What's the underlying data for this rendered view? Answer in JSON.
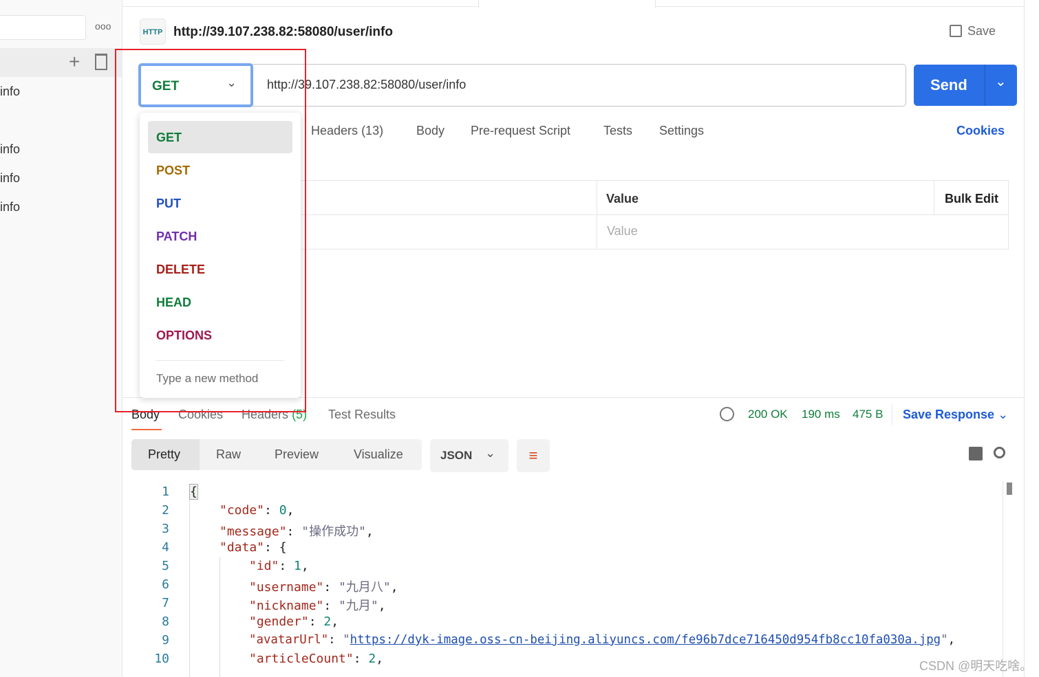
{
  "sidebar": {
    "items": [
      "info",
      "info",
      "info",
      "info"
    ],
    "more_icon": "ellipsis-icon"
  },
  "request": {
    "title": "http://39.107.238.82:58080/user/info",
    "save_label": "Save",
    "method": "GET",
    "url": "http://39.107.238.82:58080/user/info",
    "send_label": "Send",
    "tabs": [
      "Headers",
      "(13)",
      "Body",
      "Pre-request Script",
      "Tests",
      "Settings"
    ],
    "cookies_label": "Cookies",
    "table": {
      "value_header": "Value",
      "bulk_edit": "Bulk Edit",
      "value_placeholder": "Value"
    }
  },
  "method_menu": {
    "items": [
      {
        "label": "GET",
        "color": "#0f7d3a"
      },
      {
        "label": "POST",
        "color": "#a36a00"
      },
      {
        "label": "PUT",
        "color": "#1f4fc0"
      },
      {
        "label": "PATCH",
        "color": "#6e2fb0"
      },
      {
        "label": "DELETE",
        "color": "#a5201a"
      },
      {
        "label": "HEAD",
        "color": "#0f7d3a"
      },
      {
        "label": "OPTIONS",
        "color": "#a0174f"
      }
    ],
    "new_method_placeholder": "Type a new method"
  },
  "response": {
    "tabs": [
      "Body",
      "Cookies",
      "Headers",
      "(5)",
      "Test Results"
    ],
    "status": "200 OK",
    "time": "190 ms",
    "size": "475 B",
    "save_response": "Save Response",
    "views": [
      "Pretty",
      "Raw",
      "Preview",
      "Visualize"
    ],
    "format": "JSON",
    "lines": [
      "1",
      "2",
      "3",
      "4",
      "5",
      "6",
      "7",
      "8",
      "9",
      "10"
    ],
    "code": {
      "l1": "{",
      "k2": "\"code\"",
      "v2": "0",
      "k3": "\"message\"",
      "v3": "\"操作成功\"",
      "k4": "\"data\"",
      "v4": "{",
      "k5": "\"id\"",
      "v5": "1",
      "k6": "\"username\"",
      "v6": "\"九月八\"",
      "k7": "\"nickname\"",
      "v7": "\"九月\"",
      "k8": "\"gender\"",
      "v8": "2",
      "k9": "\"avatarUrl\"",
      "v9": "https://dyk-image.oss-cn-beijing.aliyuncs.com/fe96b7dce716450d954fb8cc10fa030a.jpg",
      "k10": "\"articleCount\"",
      "v10": "2"
    }
  },
  "watermark": "CSDN @明天吃啥。"
}
